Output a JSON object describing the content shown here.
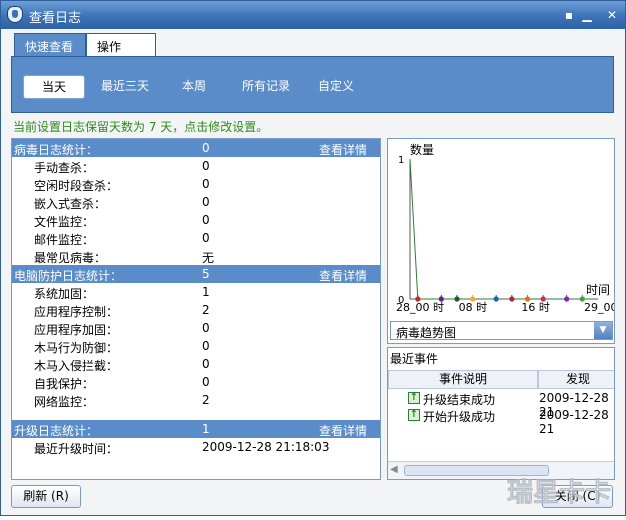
{
  "window": {
    "title": "查看日志"
  },
  "tabs": [
    {
      "label": "快速查看"
    },
    {
      "label": "操作"
    }
  ],
  "filters": [
    {
      "label": "当天"
    },
    {
      "label": "最近三天"
    },
    {
      "label": "本周"
    },
    {
      "label": "所有记录"
    },
    {
      "label": "自定义"
    }
  ],
  "notice": "当前设置日志保留天数为 7 天，点击修改设置。",
  "virus": {
    "title": "病毒日志统计：",
    "value": "0",
    "link": "查看详情",
    "rows": [
      {
        "label": "手动查杀：",
        "value": "0"
      },
      {
        "label": "空闲时段查杀：",
        "value": "0"
      },
      {
        "label": "嵌入式查杀：",
        "value": "0"
      },
      {
        "label": "文件监控：",
        "value": "0"
      },
      {
        "label": "邮件监控：",
        "value": "0"
      },
      {
        "label": "最常见病毒：",
        "value": "无"
      }
    ]
  },
  "protect": {
    "title": "电脑防护日志统计：",
    "value": "5",
    "link": "查看详情",
    "rows": [
      {
        "label": "系统加固：",
        "value": "1"
      },
      {
        "label": "应用程序控制：",
        "value": "2"
      },
      {
        "label": "应用程序加固：",
        "value": "0"
      },
      {
        "label": "木马行为防御：",
        "value": "0"
      },
      {
        "label": "木马入侵拦截：",
        "value": "0"
      },
      {
        "label": "自我保护：",
        "value": "0"
      },
      {
        "label": "网络监控：",
        "value": "2"
      }
    ]
  },
  "upgrade": {
    "title": "升级日志统计：",
    "value": "1",
    "link": "查看详情",
    "rows": [
      {
        "label": "最近升级时间：",
        "value": "2009-12-28 21:18:03"
      }
    ]
  },
  "chart_data": {
    "type": "line",
    "ylabel": "数量",
    "xlabel": "时间",
    "ylim": [
      0,
      1
    ],
    "yticks": [
      "0",
      "1"
    ],
    "xticks": [
      "28_00 时",
      "08 时",
      "16 时",
      "29_00 时"
    ],
    "series": [
      {
        "x": [
          0,
          1,
          2,
          3,
          4,
          5,
          6,
          7,
          8,
          9,
          10,
          11,
          12,
          13,
          14,
          15,
          16,
          17,
          18,
          19,
          20,
          21,
          22,
          23,
          24
        ],
        "values": [
          1,
          0,
          0,
          0,
          0,
          0,
          0,
          0,
          0,
          0,
          0,
          0,
          0,
          0,
          0,
          0,
          0,
          0,
          0,
          0,
          0,
          0,
          0,
          0,
          0
        ]
      }
    ],
    "points": [
      {
        "x": 1,
        "color": "#c62828"
      },
      {
        "x": 4,
        "color": "#6a1b9a"
      },
      {
        "x": 6,
        "color": "#1b5e20"
      },
      {
        "x": 8,
        "color": "#f9a825"
      },
      {
        "x": 11,
        "color": "#1565c0"
      },
      {
        "x": 13,
        "color": "#c2185b"
      },
      {
        "x": 15,
        "color": "#ef6c00"
      },
      {
        "x": 17,
        "color": "#e91e63"
      },
      {
        "x": 20,
        "color": "#8e24aa"
      },
      {
        "x": 22,
        "color": "#43a047"
      }
    ],
    "grid": false
  },
  "chart_select": {
    "value": "病毒趋势图"
  },
  "events": {
    "title": "最近事件",
    "columns": [
      "事件说明",
      "发现"
    ],
    "rows": [
      {
        "desc": "升级结束成功",
        "time": "2009-12-28 21"
      },
      {
        "desc": "开始升级成功",
        "time": "2009-12-28 21"
      }
    ]
  },
  "buttons": {
    "refresh": "刷新 (R)",
    "close": "关闭 (C)"
  },
  "watermark": "瑞星卡卡",
  "colors": {
    "accent": "#5a8cc9",
    "notice": "#2e8b1a"
  }
}
